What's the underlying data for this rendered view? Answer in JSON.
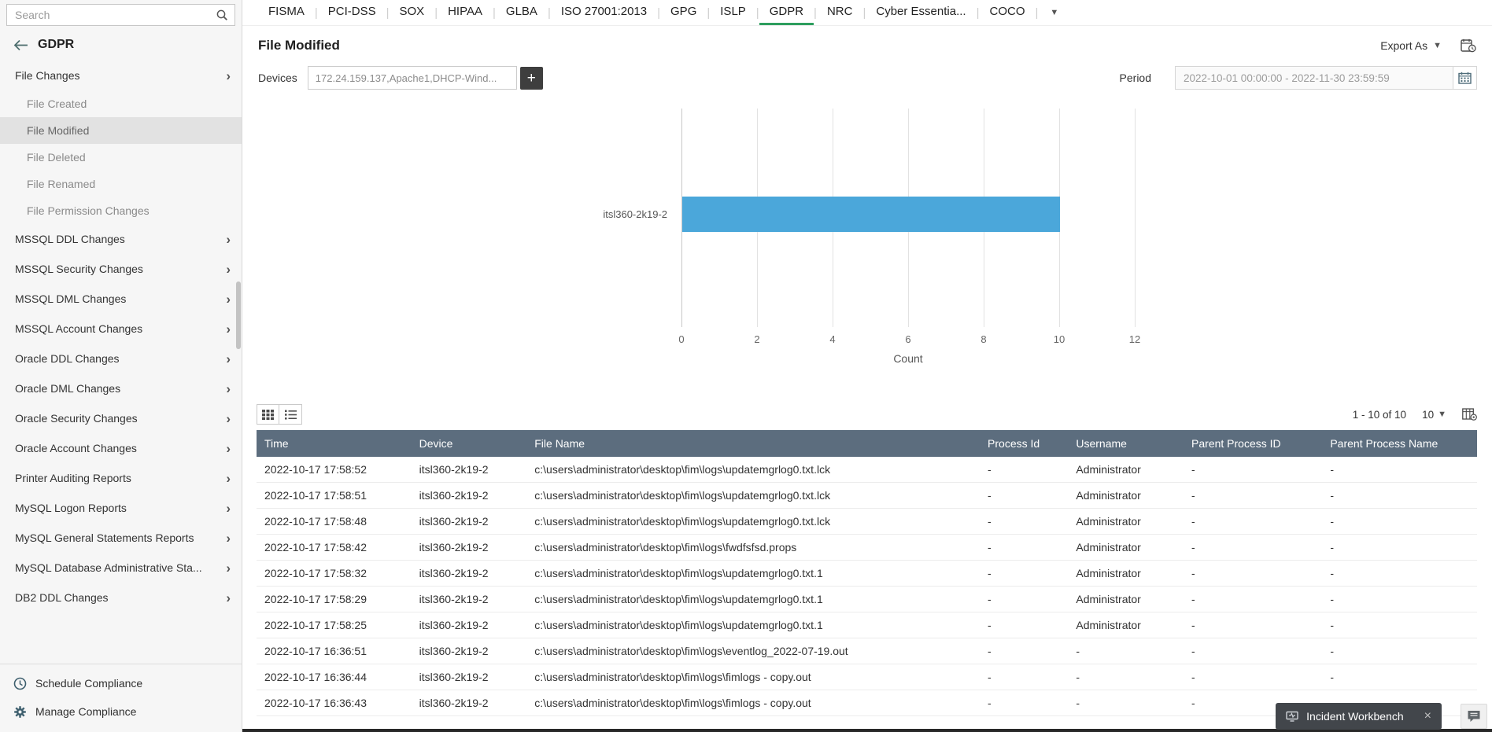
{
  "sidebar": {
    "search_placeholder": "Search",
    "title": "GDPR",
    "items": [
      {
        "label": "File Changes",
        "level": 0,
        "expandable": true
      },
      {
        "label": "File Created",
        "level": 1
      },
      {
        "label": "File Modified",
        "level": 1,
        "selected": true
      },
      {
        "label": "File Deleted",
        "level": 1
      },
      {
        "label": "File Renamed",
        "level": 1
      },
      {
        "label": "File Permission Changes",
        "level": 1
      },
      {
        "label": "MSSQL DDL Changes",
        "level": 0,
        "expandable": true
      },
      {
        "label": "MSSQL Security Changes",
        "level": 0,
        "expandable": true
      },
      {
        "label": "MSSQL DML Changes",
        "level": 0,
        "expandable": true
      },
      {
        "label": "MSSQL Account Changes",
        "level": 0,
        "expandable": true
      },
      {
        "label": "Oracle DDL Changes",
        "level": 0,
        "expandable": true
      },
      {
        "label": "Oracle DML Changes",
        "level": 0,
        "expandable": true
      },
      {
        "label": "Oracle Security Changes",
        "level": 0,
        "expandable": true
      },
      {
        "label": "Oracle Account Changes",
        "level": 0,
        "expandable": true
      },
      {
        "label": "Printer Auditing Reports",
        "level": 0,
        "expandable": true
      },
      {
        "label": "MySQL Logon Reports",
        "level": 0,
        "expandable": true
      },
      {
        "label": "MySQL General Statements Reports",
        "level": 0,
        "expandable": true
      },
      {
        "label": "MySQL Database Administrative Sta...",
        "level": 0,
        "expandable": true
      },
      {
        "label": "DB2 DDL Changes",
        "level": 0,
        "expandable": true
      }
    ],
    "footer": [
      {
        "label": "Schedule Compliance",
        "icon": "clock-icon"
      },
      {
        "label": "Manage Compliance",
        "icon": "gear-icon"
      }
    ]
  },
  "tabs": [
    "FISMA",
    "PCI-DSS",
    "SOX",
    "HIPAA",
    "GLBA",
    "ISO 27001:2013",
    "GPG",
    "ISLP",
    "GDPR",
    "NRC",
    "Cyber Essentia...",
    "COCO"
  ],
  "active_tab": "GDPR",
  "page": {
    "title": "File Modified",
    "export_label": "Export As"
  },
  "filters": {
    "devices_label": "Devices",
    "devices_value": "172.24.159.137,Apache1,DHCP-Wind...",
    "period_label": "Period",
    "period_value": "2022-10-01 00:00:00 - 2022-11-30 23:59:59"
  },
  "chart_data": {
    "type": "bar",
    "orientation": "horizontal",
    "categories": [
      "itsl360-2k19-2"
    ],
    "values": [
      10
    ],
    "title": "",
    "xlabel": "Count",
    "ylabel": "",
    "xlim": [
      0,
      12
    ],
    "xticks": [
      0,
      2,
      4,
      6,
      8,
      10,
      12
    ],
    "bar_color": "#4BA7DA",
    "grid": true,
    "legend": false
  },
  "table": {
    "pagination": "1 - 10 of 10",
    "page_size": "10",
    "columns": [
      "Time",
      "Device",
      "File Name",
      "Process Id",
      "Username",
      "Parent Process ID",
      "Parent Process Name"
    ],
    "rows": [
      [
        "2022-10-17 17:58:52",
        "itsl360-2k19-2",
        "c:\\users\\administrator\\desktop\\fim\\logs\\updatemgrlog0.txt.lck",
        "-",
        "Administrator",
        "-",
        "-"
      ],
      [
        "2022-10-17 17:58:51",
        "itsl360-2k19-2",
        "c:\\users\\administrator\\desktop\\fim\\logs\\updatemgrlog0.txt.lck",
        "-",
        "Administrator",
        "-",
        "-"
      ],
      [
        "2022-10-17 17:58:48",
        "itsl360-2k19-2",
        "c:\\users\\administrator\\desktop\\fim\\logs\\updatemgrlog0.txt.lck",
        "-",
        "Administrator",
        "-",
        "-"
      ],
      [
        "2022-10-17 17:58:42",
        "itsl360-2k19-2",
        "c:\\users\\administrator\\desktop\\fim\\logs\\fwdfsfsd.props",
        "-",
        "Administrator",
        "-",
        "-"
      ],
      [
        "2022-10-17 17:58:32",
        "itsl360-2k19-2",
        "c:\\users\\administrator\\desktop\\fim\\logs\\updatemgrlog0.txt.1",
        "-",
        "Administrator",
        "-",
        "-"
      ],
      [
        "2022-10-17 17:58:29",
        "itsl360-2k19-2",
        "c:\\users\\administrator\\desktop\\fim\\logs\\updatemgrlog0.txt.1",
        "-",
        "Administrator",
        "-",
        "-"
      ],
      [
        "2022-10-17 17:58:25",
        "itsl360-2k19-2",
        "c:\\users\\administrator\\desktop\\fim\\logs\\updatemgrlog0.txt.1",
        "-",
        "Administrator",
        "-",
        "-"
      ],
      [
        "2022-10-17 16:36:51",
        "itsl360-2k19-2",
        "c:\\users\\administrator\\desktop\\fim\\logs\\eventlog_2022-07-19.out",
        "-",
        "-",
        "-",
        "-"
      ],
      [
        "2022-10-17 16:36:44",
        "itsl360-2k19-2",
        "c:\\users\\administrator\\desktop\\fim\\logs\\fimlogs - copy.out",
        "-",
        "-",
        "-",
        "-"
      ],
      [
        "2022-10-17 16:36:43",
        "itsl360-2k19-2",
        "c:\\users\\administrator\\desktop\\fim\\logs\\fimlogs - copy.out",
        "-",
        "-",
        "-",
        "-"
      ]
    ]
  },
  "toast": {
    "label": "Incident Workbench"
  }
}
